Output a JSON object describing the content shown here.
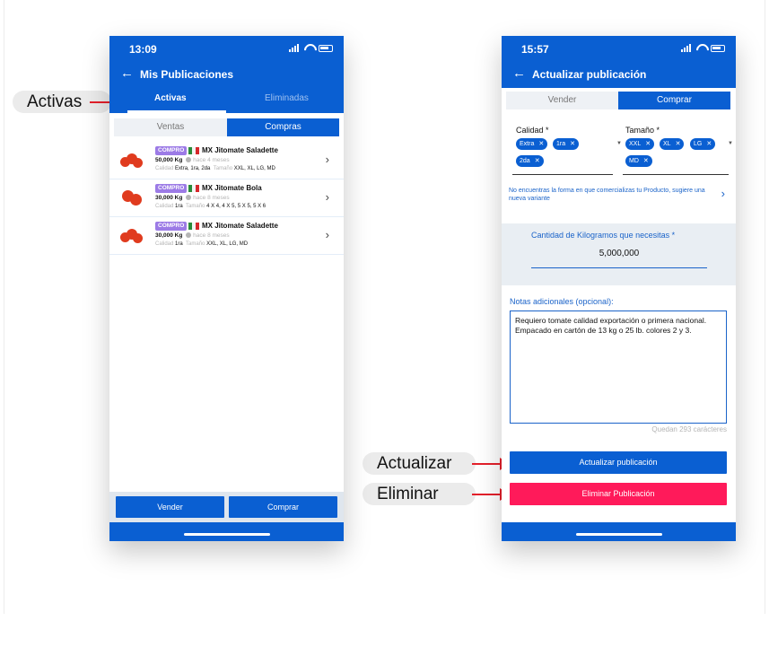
{
  "annotations": {
    "activas": "Activas",
    "actualizar": "Actualizar",
    "eliminar": "Eliminar"
  },
  "left_phone": {
    "status_time": "13:09",
    "title": "Mis Publicaciones",
    "tabs": [
      "Activas",
      "Eliminadas"
    ],
    "segments": [
      "Ventas",
      "Compras"
    ],
    "rows": [
      {
        "badge": "COMPRO",
        "title": "MX Jitomate Saladette",
        "qty": "50,000 Kg",
        "ago": "hace 4 meses",
        "calidad_label": "Calidad",
        "calidad": "Extra, 1ra, 2da",
        "tamano_label": "Tamaño",
        "tamano": "XXL, XL, LG, MD"
      },
      {
        "badge": "COMPRO",
        "title": "MX Jitomate Bola",
        "qty": "30,000 Kg",
        "ago": "hace 8 meses",
        "calidad_label": "Calidad",
        "calidad": "1ra",
        "tamano_label": "Tamaño",
        "tamano": "4 X 4, 4 X 5, 5 X 5, 5 X 6"
      },
      {
        "badge": "COMPRO",
        "title": "MX Jitomate Saladette",
        "qty": "30,000 Kg",
        "ago": "hace 8 meses",
        "calidad_label": "Calidad",
        "calidad": "1ra",
        "tamano_label": "Tamaño",
        "tamano": "XXL, XL, LG, MD"
      }
    ],
    "bottom_buttons": [
      "Vender",
      "Comprar"
    ]
  },
  "right_phone": {
    "status_time": "15:57",
    "title": "Actualizar publicación",
    "segments": [
      "Vender",
      "Comprar"
    ],
    "calidad_label": "Calidad *",
    "calidad_chips": [
      "Extra",
      "1ra",
      "2da"
    ],
    "tamano_label": "Tamaño *",
    "tamano_chips": [
      "XXL",
      "XL",
      "LG",
      "MD"
    ],
    "variant_link": "No encuentras la forma en que comercializas tu Producto, sugiere una nueva variante",
    "quantity_label": "Cantidad de Kilogramos que necesitas *",
    "quantity_value": "5,000,000",
    "notes_label": "Notas adicionales (opcional):",
    "notes_value": "Requiero tomate calidad exportación o primera nacional. Empacado en cartón de 13 kg o 25 lb. colores 2 y 3.",
    "counter": "Quedan 293 carácteres",
    "update_button": "Actualizar publicación",
    "delete_button": "Eliminar Publicación"
  },
  "colors": {
    "brand_blue": "#0a5fd2",
    "link_blue": "#1a63c9",
    "badge_purple": "#9c7be6",
    "danger_pink": "#ff1a5a",
    "arrow_red": "#e4202b"
  }
}
